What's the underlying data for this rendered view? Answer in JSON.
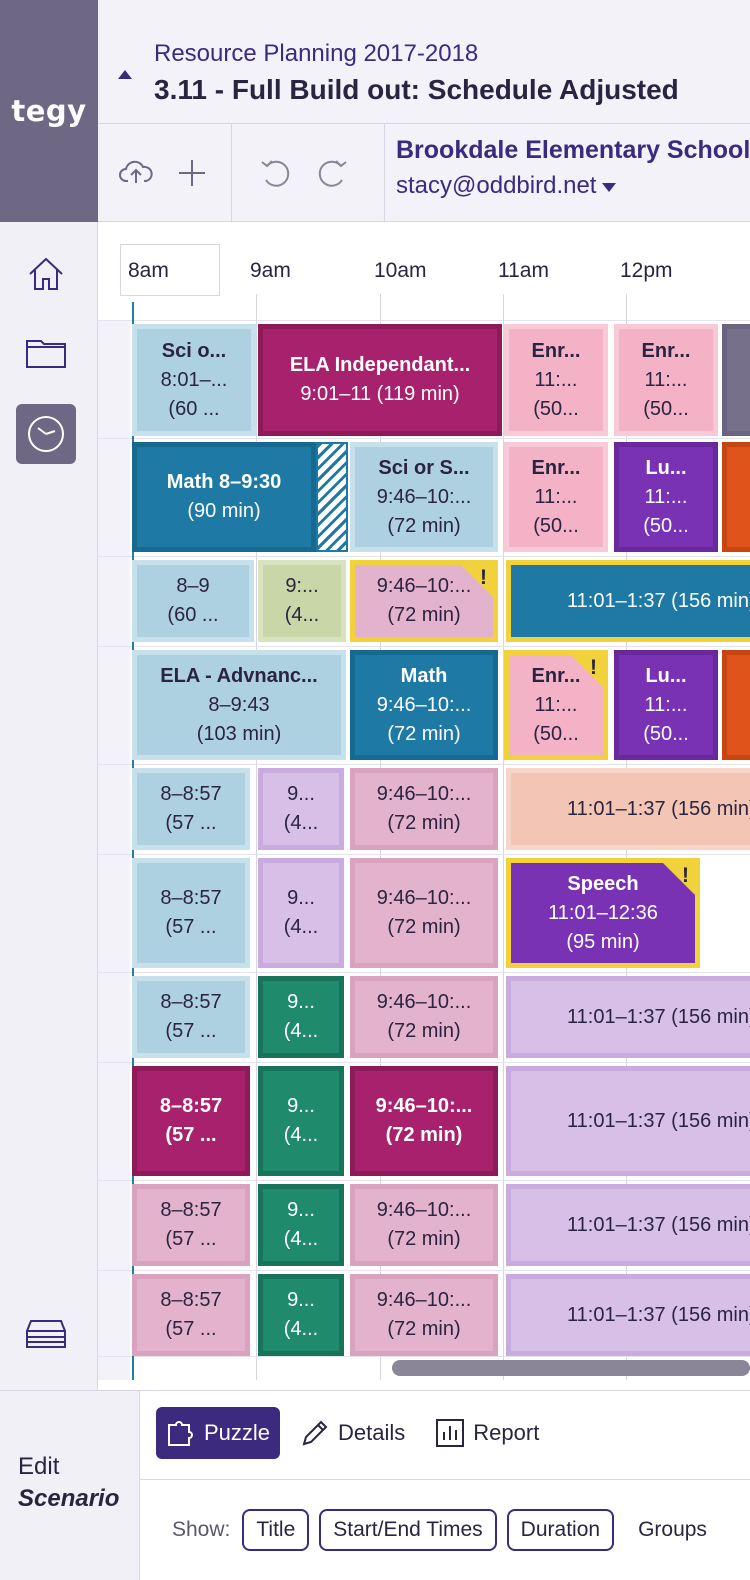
{
  "app": {
    "logo": "tegy"
  },
  "header": {
    "subtitle": "Resource Planning 2017-2018",
    "title": "3.11 - Full Build out: Schedule Adjusted",
    "school": "Brookdale Elementary School",
    "user_email": "stacy@oddbird.net"
  },
  "timeline": {
    "times": [
      "8am",
      "9am",
      "10am",
      "11am",
      "12pm"
    ]
  },
  "blocks": [
    [
      "Sci o...",
      "8:01–...",
      "(60 ..."
    ],
    [
      "ELA Independant...",
      "9:01–11 (119 min)"
    ],
    [
      "Enr...",
      "11:...",
      "(50..."
    ],
    [
      "Enr...",
      "11:...",
      "(50..."
    ],
    [
      "Math 8–9:30",
      "(90 min)"
    ],
    [
      "Sci or S...",
      "9:46–10:...",
      "(72 min)"
    ],
    [
      "Enr...",
      "11:...",
      "(50..."
    ],
    [
      "Lu...",
      "11:...",
      "(50..."
    ],
    [
      "8–9",
      "(60 ..."
    ],
    [
      "9:...",
      "(4..."
    ],
    [
      "9:46–10:...",
      "(72 min)"
    ],
    [
      "11:01–1:37 (156 min)"
    ],
    [
      "ELA - Advnanc...",
      "8–9:43",
      "(103 min)"
    ],
    [
      "Math",
      "9:46–10:...",
      "(72 min)"
    ],
    [
      "Enr...",
      "11:...",
      "(50..."
    ],
    [
      "Lu...",
      "11:...",
      "(50..."
    ],
    [
      "8–8:57",
      "(57 ..."
    ],
    [
      "9...",
      "(4..."
    ],
    [
      "9:46–10:...",
      "(72 min)"
    ],
    [
      "11:01–1:37 (156 min)"
    ],
    [
      "8–8:57",
      "(57 ..."
    ],
    [
      "9...",
      "(4..."
    ],
    [
      "9:46–10:...",
      "(72 min)"
    ],
    [
      "Speech",
      "11:01–12:36",
      "(95 min)"
    ],
    [
      "8–8:57",
      "(57 ..."
    ],
    [
      "9...",
      "(4..."
    ],
    [
      "9:46–10:...",
      "(72 min)"
    ],
    [
      "11:01–1:37 (156 min)"
    ],
    [
      "8–8:57",
      "(57 ..."
    ],
    [
      "9...",
      "(4..."
    ],
    [
      "9:46–10:...",
      "(72 min)"
    ],
    [
      "11:01–1:37 (156 min)"
    ],
    [
      "8–8:57",
      "(57 ..."
    ],
    [
      "9...",
      "(4..."
    ],
    [
      "9:46–10:...",
      "(72 min)"
    ],
    [
      "11:01–1:37 (156 min)"
    ],
    [
      "8–8:57",
      "(57 ..."
    ],
    [
      "9...",
      "(4..."
    ],
    [
      "9:46–10:...",
      "(72 min)"
    ],
    [
      "11:01–1:37 (156 min)"
    ]
  ],
  "warning_mark": "!",
  "bottom": {
    "edit_label": "Edit",
    "scenario_label": "Scenario",
    "tabs": [
      "Puzzle",
      "Details",
      "Report"
    ],
    "show_label": "Show:",
    "show_options": [
      "Title",
      "Start/End Times",
      "Duration",
      "Groups"
    ]
  }
}
